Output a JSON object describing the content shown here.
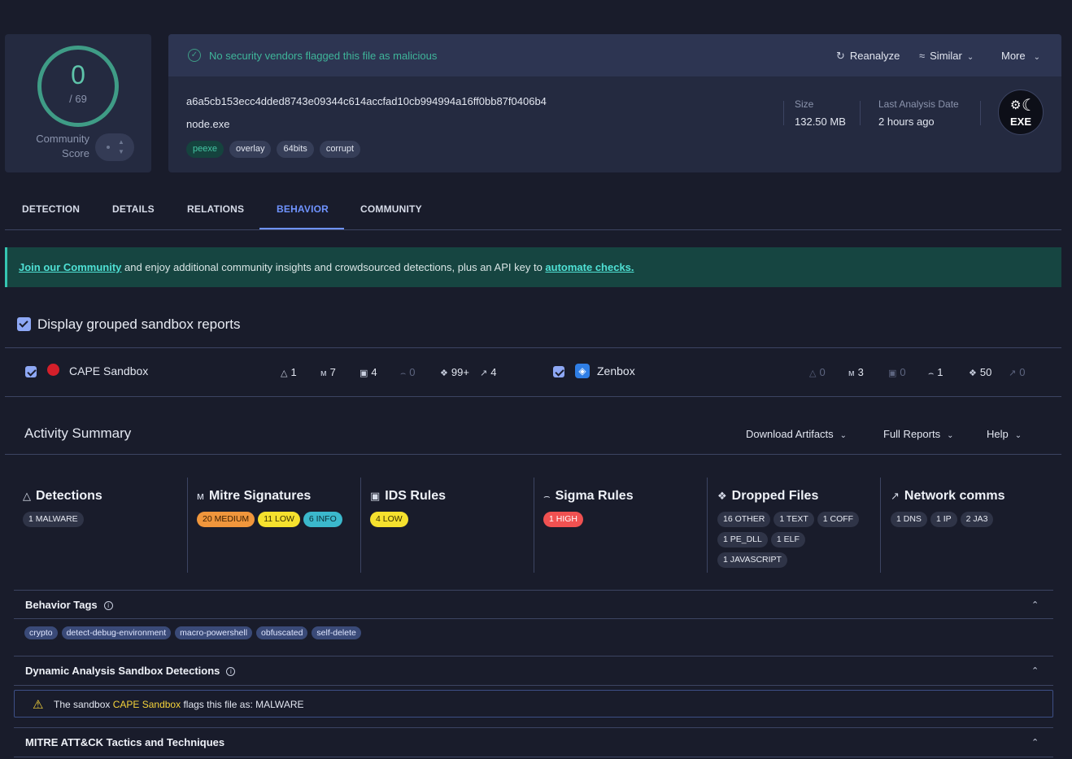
{
  "score": {
    "value": "0",
    "total": "/ 69",
    "label_line1": "Community",
    "label_line2": "Score"
  },
  "banner": {
    "text": "No security vendors flagged this file as malicious",
    "color": "#3fb59a"
  },
  "actions": {
    "reanalyze": "Reanalyze",
    "similar": "Similar",
    "more": "More"
  },
  "file": {
    "hash": "a6a5cb153ecc4dded8743e09344c614accfad10cb994994a16ff0bb87f0406b4",
    "name": "node.exe",
    "tags": [
      "peexe",
      "overlay",
      "64bits",
      "corrupt"
    ],
    "size_label": "Size",
    "size_value": "132.50 MB",
    "date_label": "Last Analysis Date",
    "date_value": "2 hours ago",
    "type_icon": "EXE"
  },
  "tabs": [
    "DETECTION",
    "DETAILS",
    "RELATIONS",
    "BEHAVIOR",
    "COMMUNITY"
  ],
  "active_tab": "BEHAVIOR",
  "community_banner": {
    "link1": "Join our Community",
    "middle": " and enjoy additional community insights and crowdsourced detections, plus an API key to ",
    "link2": "automate checks."
  },
  "grouped_label": "Display grouped sandbox reports",
  "sandboxes": [
    {
      "name": "CAPE Sandbox",
      "stats": {
        "detections": "1",
        "mitre": "7",
        "ids": "4",
        "sigma": "0",
        "dropped": "99+",
        "network": "4"
      }
    },
    {
      "name": "Zenbox",
      "stats": {
        "detections": "0",
        "mitre": "3",
        "ids": "0",
        "sigma": "1",
        "dropped": "50",
        "network": "0"
      }
    }
  ],
  "activity": {
    "title": "Activity Summary",
    "menus": {
      "download": "Download Artifacts",
      "full_reports": "Full Reports",
      "help": "Help"
    },
    "columns": {
      "detections": {
        "title": "Detections",
        "pills": [
          "1 MALWARE"
        ]
      },
      "mitre": {
        "title": "Mitre Signatures",
        "pills": [
          "20 MEDIUM",
          "11 LOW",
          "6 INFO"
        ]
      },
      "ids": {
        "title": "IDS Rules",
        "pills": [
          "4 LOW"
        ]
      },
      "sigma": {
        "title": "Sigma Rules",
        "pills": [
          "1 HIGH"
        ]
      },
      "dropped": {
        "title": "Dropped Files",
        "pills": [
          "16 OTHER",
          "1 TEXT",
          "1 COFF",
          "1 PE_DLL",
          "1 ELF",
          "1 JAVASCRIPT"
        ]
      },
      "network": {
        "title": "Network comms",
        "pills": [
          "1 DNS",
          "1 IP",
          "2 JA3"
        ]
      }
    }
  },
  "sections": {
    "behavior_tags": {
      "title": "Behavior Tags",
      "tags": [
        "crypto",
        "detect-debug-environment",
        "macro-powershell",
        "obfuscated",
        "self-delete"
      ]
    },
    "dynamic": {
      "title": "Dynamic Analysis Sandbox Detections",
      "prefix": "The sandbox ",
      "sandbox": "CAPE Sandbox",
      "suffix": " flags this file as: MALWARE"
    },
    "mitre": {
      "title": "MITRE ATT&CK Tactics and Techniques"
    }
  }
}
